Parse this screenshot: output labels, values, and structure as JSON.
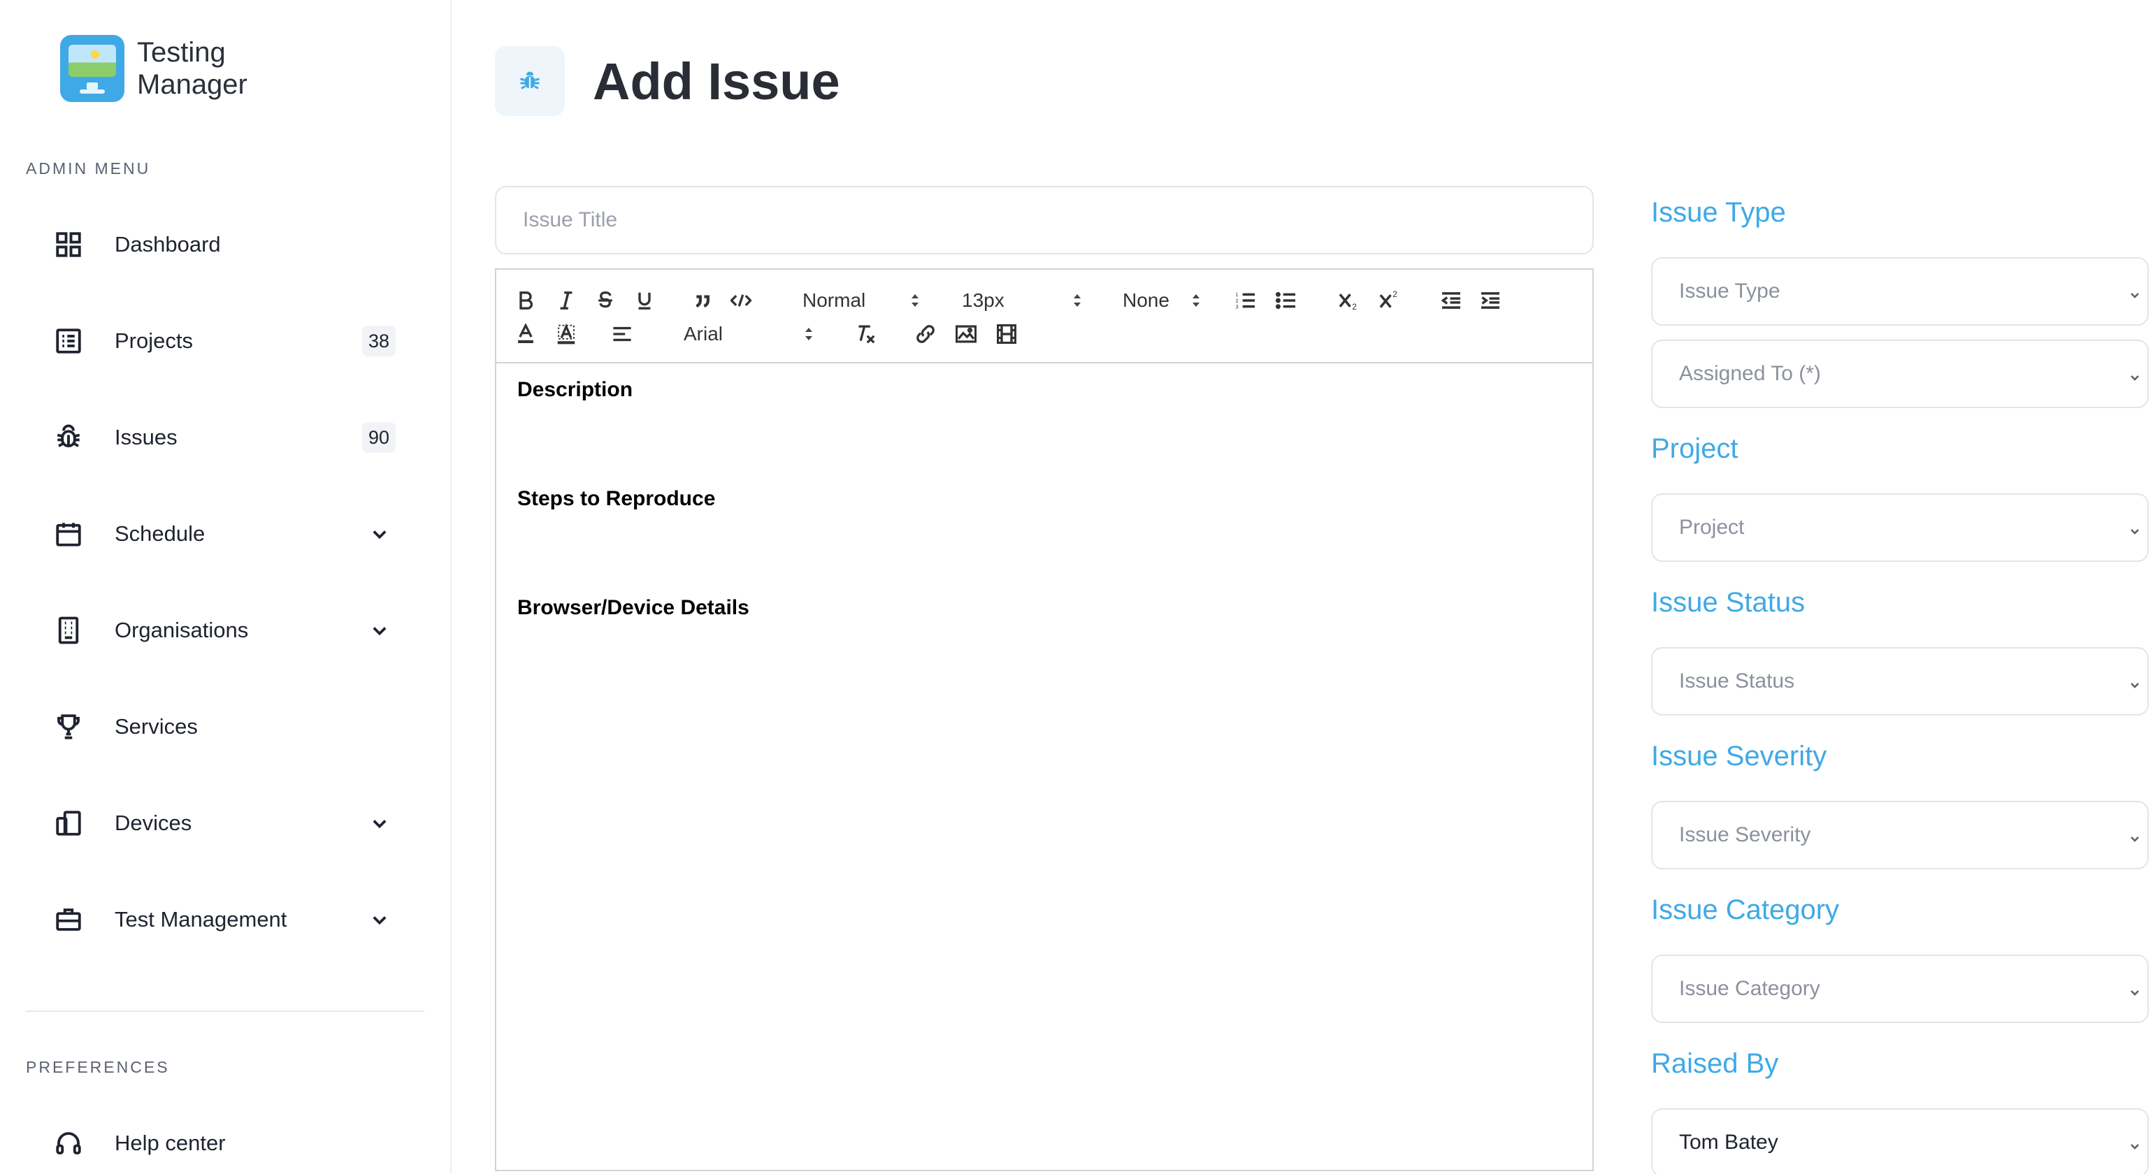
{
  "brand": {
    "line1": "Testing",
    "line2": "Manager"
  },
  "sidebar": {
    "admin_label": "ADMIN MENU",
    "items": [
      {
        "label": "Dashboard",
        "icon": "grid-icon"
      },
      {
        "label": "Projects",
        "icon": "list-icon",
        "badge": "38"
      },
      {
        "label": "Issues",
        "icon": "bug-icon",
        "badge": "90"
      },
      {
        "label": "Schedule",
        "icon": "calendar-icon",
        "expandable": true
      },
      {
        "label": "Organisations",
        "icon": "building-icon",
        "expandable": true
      },
      {
        "label": "Services",
        "icon": "trophy-icon"
      },
      {
        "label": "Devices",
        "icon": "devices-icon",
        "expandable": true
      },
      {
        "label": "Test Management",
        "icon": "briefcase-icon",
        "expandable": true
      }
    ],
    "preferences_label": "PREFERENCES",
    "help": {
      "label": "Help center",
      "icon": "headset-icon"
    }
  },
  "header": {
    "title": "Add Issue",
    "icon": "bug-icon"
  },
  "form": {
    "title_placeholder": "Issue Title",
    "toolbar": {
      "header_select": "Normal",
      "size_select": "13px",
      "line_select": "None",
      "font_select": "Arial"
    },
    "editor_sections": [
      "Description",
      "Steps to Reproduce",
      "Browser/Device Details"
    ]
  },
  "panel": {
    "issue_type_heading": "Issue Type",
    "issue_type_placeholder": "Issue Type",
    "assigned_placeholder": "Assigned To (*)",
    "project_heading": "Project",
    "project_placeholder": "Project",
    "status_heading": "Issue Status",
    "status_placeholder": "Issue Status",
    "severity_heading": "Issue Severity",
    "severity_placeholder": "Issue Severity",
    "category_heading": "Issue Category",
    "category_placeholder": "Issue Category",
    "raised_heading": "Raised By",
    "raised_value": "Tom Batey"
  },
  "colors": {
    "accent": "#3fa9e6",
    "text": "#1f2330",
    "border": "#e2e5ea"
  }
}
